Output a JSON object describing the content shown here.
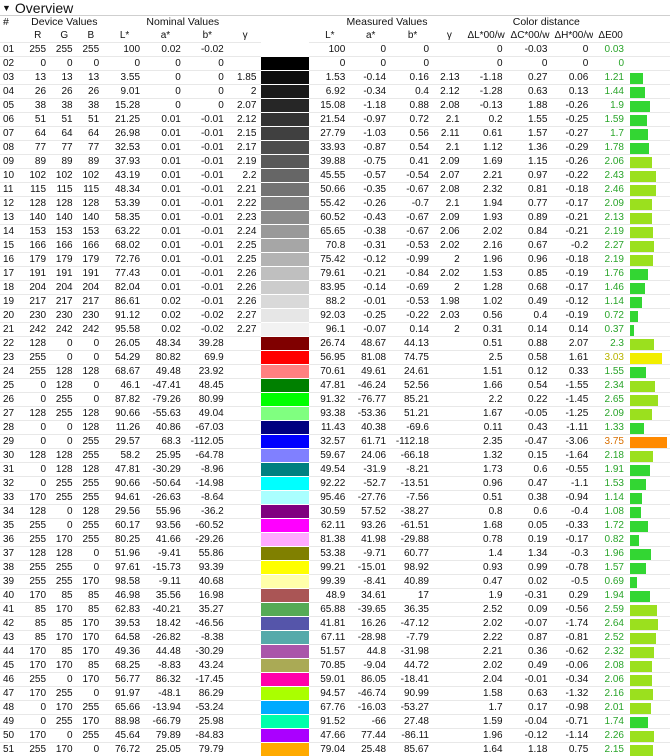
{
  "section": {
    "title": "Overview",
    "toggle_icon": "triangle-down"
  },
  "header": {
    "index": "#",
    "groups": {
      "device": "Device Values",
      "nominal": "Nominal Values",
      "measured": "Measured Values",
      "distance": "Color distance"
    },
    "device_cols": [
      "R",
      "G",
      "B"
    ],
    "nominal_cols": [
      "L*",
      "a*",
      "b*",
      "γ"
    ],
    "measured_cols": [
      "L*",
      "a*",
      "b*",
      "γ"
    ],
    "distance_cols": [
      "ΔL*00/w",
      "ΔC*00/w",
      "ΔH*00/w",
      "ΔE00"
    ]
  },
  "colors": {
    "green": "#33d633",
    "green_light": "#9be01e",
    "yellow": "#f2ee00",
    "orange": "#ff8a00"
  },
  "rows": [
    {
      "id": "01",
      "r": "255",
      "g": "255",
      "b": "255",
      "nl": "100",
      "na": "0.02",
      "nb": "-0.02",
      "ng": "",
      "swatch": "#ffffff",
      "ml": "100",
      "ma": "0",
      "mb": "0",
      "mg": "",
      "dl": "0",
      "dc": "-0.03",
      "dh": "0",
      "de": "0.03"
    },
    {
      "id": "02",
      "r": "0",
      "g": "0",
      "b": "0",
      "nl": "0",
      "na": "0",
      "nb": "0",
      "ng": "",
      "swatch": "#000000",
      "ml": "0",
      "ma": "0",
      "mb": "0",
      "mg": "",
      "dl": "0",
      "dc": "0",
      "dh": "0",
      "de": "0"
    },
    {
      "id": "03",
      "r": "13",
      "g": "13",
      "b": "13",
      "nl": "3.55",
      "na": "0",
      "nb": "0",
      "ng": "1.85",
      "swatch": "#0d0d0d",
      "ml": "1.53",
      "ma": "-0.14",
      "mb": "0.16",
      "mg": "2.13",
      "dl": "-1.18",
      "dc": "0.27",
      "dh": "0.06",
      "de": "1.21"
    },
    {
      "id": "04",
      "r": "26",
      "g": "26",
      "b": "26",
      "nl": "9.01",
      "na": "0",
      "nb": "0",
      "ng": "2",
      "swatch": "#1a1a1a",
      "ml": "6.92",
      "ma": "-0.34",
      "mb": "0.4",
      "mg": "2.12",
      "dl": "-1.28",
      "dc": "0.63",
      "dh": "0.13",
      "de": "1.44"
    },
    {
      "id": "05",
      "r": "38",
      "g": "38",
      "b": "38",
      "nl": "15.28",
      "na": "0",
      "nb": "0",
      "ng": "2.07",
      "swatch": "#262626",
      "ml": "15.08",
      "ma": "-1.18",
      "mb": "0.88",
      "mg": "2.08",
      "dl": "-0.13",
      "dc": "1.88",
      "dh": "-0.26",
      "de": "1.9"
    },
    {
      "id": "06",
      "r": "51",
      "g": "51",
      "b": "51",
      "nl": "21.25",
      "na": "0.01",
      "nb": "-0.01",
      "ng": "2.12",
      "swatch": "#333333",
      "ml": "21.54",
      "ma": "-0.97",
      "mb": "0.72",
      "mg": "2.1",
      "dl": "0.2",
      "dc": "1.55",
      "dh": "-0.25",
      "de": "1.59"
    },
    {
      "id": "07",
      "r": "64",
      "g": "64",
      "b": "64",
      "nl": "26.98",
      "na": "0.01",
      "nb": "-0.01",
      "ng": "2.15",
      "swatch": "#404040",
      "ml": "27.79",
      "ma": "-1.03",
      "mb": "0.56",
      "mg": "2.11",
      "dl": "0.61",
      "dc": "1.57",
      "dh": "-0.27",
      "de": "1.7"
    },
    {
      "id": "08",
      "r": "77",
      "g": "77",
      "b": "77",
      "nl": "32.53",
      "na": "0.01",
      "nb": "-0.01",
      "ng": "2.17",
      "swatch": "#4d4d4d",
      "ml": "33.93",
      "ma": "-0.87",
      "mb": "0.54",
      "mg": "2.1",
      "dl": "1.12",
      "dc": "1.36",
      "dh": "-0.29",
      "de": "1.78"
    },
    {
      "id": "09",
      "r": "89",
      "g": "89",
      "b": "89",
      "nl": "37.93",
      "na": "0.01",
      "nb": "-0.01",
      "ng": "2.19",
      "swatch": "#595959",
      "ml": "39.88",
      "ma": "-0.75",
      "mb": "0.41",
      "mg": "2.09",
      "dl": "1.69",
      "dc": "1.15",
      "dh": "-0.26",
      "de": "2.06"
    },
    {
      "id": "10",
      "r": "102",
      "g": "102",
      "b": "102",
      "nl": "43.19",
      "na": "0.01",
      "nb": "-0.01",
      "ng": "2.2",
      "swatch": "#666666",
      "ml": "45.55",
      "ma": "-0.57",
      "mb": "-0.54",
      "mg": "2.07",
      "dl": "2.21",
      "dc": "0.97",
      "dh": "-0.22",
      "de": "2.43"
    },
    {
      "id": "11",
      "r": "115",
      "g": "115",
      "b": "115",
      "nl": "48.34",
      "na": "0.01",
      "nb": "-0.01",
      "ng": "2.21",
      "swatch": "#737373",
      "ml": "50.66",
      "ma": "-0.35",
      "mb": "-0.67",
      "mg": "2.08",
      "dl": "2.32",
      "dc": "0.81",
      "dh": "-0.18",
      "de": "2.46"
    },
    {
      "id": "12",
      "r": "128",
      "g": "128",
      "b": "128",
      "nl": "53.39",
      "na": "0.01",
      "nb": "-0.01",
      "ng": "2.22",
      "swatch": "#808080",
      "ml": "55.42",
      "ma": "-0.26",
      "mb": "-0.7",
      "mg": "2.1",
      "dl": "1.94",
      "dc": "0.77",
      "dh": "-0.17",
      "de": "2.09"
    },
    {
      "id": "13",
      "r": "140",
      "g": "140",
      "b": "140",
      "nl": "58.35",
      "na": "0.01",
      "nb": "-0.01",
      "ng": "2.23",
      "swatch": "#8c8c8c",
      "ml": "60.52",
      "ma": "-0.43",
      "mb": "-0.67",
      "mg": "2.09",
      "dl": "1.93",
      "dc": "0.89",
      "dh": "-0.21",
      "de": "2.13"
    },
    {
      "id": "14",
      "r": "153",
      "g": "153",
      "b": "153",
      "nl": "63.22",
      "na": "0.01",
      "nb": "-0.01",
      "ng": "2.24",
      "swatch": "#999999",
      "ml": "65.65",
      "ma": "-0.38",
      "mb": "-0.67",
      "mg": "2.06",
      "dl": "2.02",
      "dc": "0.84",
      "dh": "-0.21",
      "de": "2.19"
    },
    {
      "id": "15",
      "r": "166",
      "g": "166",
      "b": "166",
      "nl": "68.02",
      "na": "0.01",
      "nb": "-0.01",
      "ng": "2.25",
      "swatch": "#a6a6a6",
      "ml": "70.8",
      "ma": "-0.31",
      "mb": "-0.53",
      "mg": "2.02",
      "dl": "2.16",
      "dc": "0.67",
      "dh": "-0.2",
      "de": "2.27"
    },
    {
      "id": "16",
      "r": "179",
      "g": "179",
      "b": "179",
      "nl": "72.76",
      "na": "0.01",
      "nb": "-0.01",
      "ng": "2.25",
      "swatch": "#b3b3b3",
      "ml": "75.42",
      "ma": "-0.12",
      "mb": "-0.99",
      "mg": "2",
      "dl": "1.96",
      "dc": "0.96",
      "dh": "-0.18",
      "de": "2.19"
    },
    {
      "id": "17",
      "r": "191",
      "g": "191",
      "b": "191",
      "nl": "77.43",
      "na": "0.01",
      "nb": "-0.01",
      "ng": "2.26",
      "swatch": "#bfbfbf",
      "ml": "79.61",
      "ma": "-0.21",
      "mb": "-0.84",
      "mg": "2.02",
      "dl": "1.53",
      "dc": "0.85",
      "dh": "-0.19",
      "de": "1.76"
    },
    {
      "id": "18",
      "r": "204",
      "g": "204",
      "b": "204",
      "nl": "82.04",
      "na": "0.01",
      "nb": "-0.01",
      "ng": "2.26",
      "swatch": "#cccccc",
      "ml": "83.95",
      "ma": "-0.14",
      "mb": "-0.69",
      "mg": "2",
      "dl": "1.28",
      "dc": "0.68",
      "dh": "-0.17",
      "de": "1.46"
    },
    {
      "id": "19",
      "r": "217",
      "g": "217",
      "b": "217",
      "nl": "86.61",
      "na": "0.02",
      "nb": "-0.01",
      "ng": "2.26",
      "swatch": "#d9d9d9",
      "ml": "88.2",
      "ma": "-0.01",
      "mb": "-0.53",
      "mg": "1.98",
      "dl": "1.02",
      "dc": "0.49",
      "dh": "-0.12",
      "de": "1.14"
    },
    {
      "id": "20",
      "r": "230",
      "g": "230",
      "b": "230",
      "nl": "91.12",
      "na": "0.02",
      "nb": "-0.02",
      "ng": "2.27",
      "swatch": "#e6e6e6",
      "ml": "92.03",
      "ma": "-0.25",
      "mb": "-0.22",
      "mg": "2.03",
      "dl": "0.56",
      "dc": "0.4",
      "dh": "-0.19",
      "de": "0.72"
    },
    {
      "id": "21",
      "r": "242",
      "g": "242",
      "b": "242",
      "nl": "95.58",
      "na": "0.02",
      "nb": "-0.02",
      "ng": "2.27",
      "swatch": "#f2f2f2",
      "ml": "96.1",
      "ma": "-0.07",
      "mb": "0.14",
      "mg": "2",
      "dl": "0.31",
      "dc": "0.14",
      "dh": "0.14",
      "de": "0.37"
    },
    {
      "id": "22",
      "r": "128",
      "g": "0",
      "b": "0",
      "nl": "26.05",
      "na": "48.34",
      "nb": "39.28",
      "ng": "",
      "swatch": "#800000",
      "ml": "26.74",
      "ma": "48.67",
      "mb": "44.13",
      "mg": "",
      "dl": "0.51",
      "dc": "0.88",
      "dh": "2.07",
      "de": "2.3"
    },
    {
      "id": "23",
      "r": "255",
      "g": "0",
      "b": "0",
      "nl": "54.29",
      "na": "80.82",
      "nb": "69.9",
      "ng": "",
      "swatch": "#ff0000",
      "ml": "56.95",
      "ma": "81.08",
      "mb": "74.75",
      "mg": "",
      "dl": "2.5",
      "dc": "0.58",
      "dh": "1.61",
      "de": "3.03"
    },
    {
      "id": "24",
      "r": "255",
      "g": "128",
      "b": "128",
      "nl": "68.67",
      "na": "49.48",
      "nb": "23.92",
      "ng": "",
      "swatch": "#ff8080",
      "ml": "70.61",
      "ma": "49.61",
      "mb": "24.61",
      "mg": "",
      "dl": "1.51",
      "dc": "0.12",
      "dh": "0.33",
      "de": "1.55"
    },
    {
      "id": "25",
      "r": "0",
      "g": "128",
      "b": "0",
      "nl": "46.1",
      "na": "-47.41",
      "nb": "48.45",
      "ng": "",
      "swatch": "#008000",
      "ml": "47.81",
      "ma": "-46.24",
      "mb": "52.56",
      "mg": "",
      "dl": "1.66",
      "dc": "0.54",
      "dh": "-1.55",
      "de": "2.34"
    },
    {
      "id": "26",
      "r": "0",
      "g": "255",
      "b": "0",
      "nl": "87.82",
      "na": "-79.26",
      "nb": "80.99",
      "ng": "",
      "swatch": "#00ff00",
      "ml": "91.32",
      "ma": "-76.77",
      "mb": "85.21",
      "mg": "",
      "dl": "2.2",
      "dc": "0.22",
      "dh": "-1.45",
      "de": "2.65"
    },
    {
      "id": "27",
      "r": "128",
      "g": "255",
      "b": "128",
      "nl": "90.66",
      "na": "-55.63",
      "nb": "49.04",
      "ng": "",
      "swatch": "#80ff80",
      "ml": "93.38",
      "ma": "-53.36",
      "mb": "51.21",
      "mg": "",
      "dl": "1.67",
      "dc": "-0.05",
      "dh": "-1.25",
      "de": "2.09"
    },
    {
      "id": "28",
      "r": "0",
      "g": "0",
      "b": "128",
      "nl": "11.26",
      "na": "40.86",
      "nb": "-67.03",
      "ng": "",
      "swatch": "#000080",
      "ml": "11.43",
      "ma": "40.38",
      "mb": "-69.6",
      "mg": "",
      "dl": "0.11",
      "dc": "0.43",
      "dh": "-1.11",
      "de": "1.33"
    },
    {
      "id": "29",
      "r": "0",
      "g": "0",
      "b": "255",
      "nl": "29.57",
      "na": "68.3",
      "nb": "-112.05",
      "ng": "",
      "swatch": "#0000ff",
      "ml": "32.57",
      "ma": "61.71",
      "mb": "-112.18",
      "mg": "",
      "dl": "2.35",
      "dc": "-0.47",
      "dh": "-3.06",
      "de": "3.75"
    },
    {
      "id": "30",
      "r": "128",
      "g": "128",
      "b": "255",
      "nl": "58.2",
      "na": "25.95",
      "nb": "-64.78",
      "ng": "",
      "swatch": "#8080ff",
      "ml": "59.67",
      "ma": "24.06",
      "mb": "-66.18",
      "mg": "",
      "dl": "1.32",
      "dc": "0.15",
      "dh": "-1.64",
      "de": "2.18"
    },
    {
      "id": "31",
      "r": "0",
      "g": "128",
      "b": "128",
      "nl": "47.81",
      "na": "-30.29",
      "nb": "-8.96",
      "ng": "",
      "swatch": "#008080",
      "ml": "49.54",
      "ma": "-31.9",
      "mb": "-8.21",
      "mg": "",
      "dl": "1.73",
      "dc": "0.6",
      "dh": "-0.55",
      "de": "1.91"
    },
    {
      "id": "32",
      "r": "0",
      "g": "255",
      "b": "255",
      "nl": "90.66",
      "na": "-50.64",
      "nb": "-14.98",
      "ng": "",
      "swatch": "#00ffff",
      "ml": "92.22",
      "ma": "-52.7",
      "mb": "-13.51",
      "mg": "",
      "dl": "0.96",
      "dc": "0.47",
      "dh": "-1.1",
      "de": "1.53"
    },
    {
      "id": "33",
      "r": "170",
      "g": "255",
      "b": "255",
      "nl": "94.61",
      "na": "-26.63",
      "nb": "-8.64",
      "ng": "",
      "swatch": "#aaffff",
      "ml": "95.46",
      "ma": "-27.76",
      "mb": "-7.56",
      "mg": "",
      "dl": "0.51",
      "dc": "0.38",
      "dh": "-0.94",
      "de": "1.14"
    },
    {
      "id": "34",
      "r": "128",
      "g": "0",
      "b": "128",
      "nl": "29.56",
      "na": "55.96",
      "nb": "-36.2",
      "ng": "",
      "swatch": "#800080",
      "ml": "30.59",
      "ma": "57.52",
      "mb": "-38.27",
      "mg": "",
      "dl": "0.8",
      "dc": "0.6",
      "dh": "-0.4",
      "de": "1.08"
    },
    {
      "id": "35",
      "r": "255",
      "g": "0",
      "b": "255",
      "nl": "60.17",
      "na": "93.56",
      "nb": "-60.52",
      "ng": "",
      "swatch": "#ff00ff",
      "ml": "62.11",
      "ma": "93.26",
      "mb": "-61.51",
      "mg": "",
      "dl": "1.68",
      "dc": "0.05",
      "dh": "-0.33",
      "de": "1.72"
    },
    {
      "id": "36",
      "r": "255",
      "g": "170",
      "b": "255",
      "nl": "80.25",
      "na": "41.66",
      "nb": "-29.26",
      "ng": "",
      "swatch": "#ffaaff",
      "ml": "81.38",
      "ma": "41.98",
      "mb": "-29.88",
      "mg": "",
      "dl": "0.78",
      "dc": "0.19",
      "dh": "-0.17",
      "de": "0.82"
    },
    {
      "id": "37",
      "r": "128",
      "g": "128",
      "b": "0",
      "nl": "51.96",
      "na": "-9.41",
      "nb": "55.86",
      "ng": "",
      "swatch": "#808000",
      "ml": "53.38",
      "ma": "-9.71",
      "mb": "60.77",
      "mg": "",
      "dl": "1.4",
      "dc": "1.34",
      "dh": "-0.3",
      "de": "1.96"
    },
    {
      "id": "38",
      "r": "255",
      "g": "255",
      "b": "0",
      "nl": "97.61",
      "na": "-15.73",
      "nb": "93.39",
      "ng": "",
      "swatch": "#ffff00",
      "ml": "99.21",
      "ma": "-15.01",
      "mb": "98.92",
      "mg": "",
      "dl": "0.93",
      "dc": "0.99",
      "dh": "-0.78",
      "de": "1.57"
    },
    {
      "id": "39",
      "r": "255",
      "g": "255",
      "b": "170",
      "nl": "98.58",
      "na": "-9.11",
      "nb": "40.68",
      "ng": "",
      "swatch": "#ffffaa",
      "ml": "99.39",
      "ma": "-8.41",
      "mb": "40.89",
      "mg": "",
      "dl": "0.47",
      "dc": "0.02",
      "dh": "-0.5",
      "de": "0.69"
    },
    {
      "id": "40",
      "r": "170",
      "g": "85",
      "b": "85",
      "nl": "46.98",
      "na": "35.56",
      "nb": "16.98",
      "ng": "",
      "swatch": "#aa5555",
      "ml": "48.9",
      "ma": "34.61",
      "mb": "17",
      "mg": "",
      "dl": "1.9",
      "dc": "-0.31",
      "dh": "0.29",
      "de": "1.94"
    },
    {
      "id": "41",
      "r": "85",
      "g": "170",
      "b": "85",
      "nl": "62.83",
      "na": "-40.21",
      "nb": "35.27",
      "ng": "",
      "swatch": "#55aa55",
      "ml": "65.88",
      "ma": "-39.65",
      "mb": "36.35",
      "mg": "",
      "dl": "2.52",
      "dc": "0.09",
      "dh": "-0.56",
      "de": "2.59"
    },
    {
      "id": "42",
      "r": "85",
      "g": "85",
      "b": "170",
      "nl": "39.53",
      "na": "18.42",
      "nb": "-46.56",
      "ng": "",
      "swatch": "#5555aa",
      "ml": "41.81",
      "ma": "16.26",
      "mb": "-47.12",
      "mg": "",
      "dl": "2.02",
      "dc": "-0.07",
      "dh": "-1.74",
      "de": "2.64"
    },
    {
      "id": "43",
      "r": "85",
      "g": "170",
      "b": "170",
      "nl": "64.58",
      "na": "-26.82",
      "nb": "-8.38",
      "ng": "",
      "swatch": "#55aaaa",
      "ml": "67.11",
      "ma": "-28.98",
      "mb": "-7.79",
      "mg": "",
      "dl": "2.22",
      "dc": "0.87",
      "dh": "-0.81",
      "de": "2.52"
    },
    {
      "id": "44",
      "r": "170",
      "g": "85",
      "b": "170",
      "nl": "49.36",
      "na": "44.48",
      "nb": "-30.29",
      "ng": "",
      "swatch": "#aa55aa",
      "ml": "51.57",
      "ma": "44.8",
      "mb": "-31.98",
      "mg": "",
      "dl": "2.21",
      "dc": "0.36",
      "dh": "-0.62",
      "de": "2.32"
    },
    {
      "id": "45",
      "r": "170",
      "g": "170",
      "b": "85",
      "nl": "68.25",
      "na": "-8.83",
      "nb": "43.24",
      "ng": "",
      "swatch": "#aaaa55",
      "ml": "70.85",
      "ma": "-9.04",
      "mb": "44.72",
      "mg": "",
      "dl": "2.02",
      "dc": "0.49",
      "dh": "-0.06",
      "de": "2.08"
    },
    {
      "id": "46",
      "r": "255",
      "g": "0",
      "b": "170",
      "nl": "56.77",
      "na": "86.32",
      "nb": "-17.45",
      "ng": "",
      "swatch": "#ff00aa",
      "ml": "59.01",
      "ma": "86.05",
      "mb": "-18.41",
      "mg": "",
      "dl": "2.04",
      "dc": "-0.01",
      "dh": "-0.34",
      "de": "2.06"
    },
    {
      "id": "47",
      "r": "170",
      "g": "255",
      "b": "0",
      "nl": "91.97",
      "na": "-48.1",
      "nb": "86.29",
      "ng": "",
      "swatch": "#aaff00",
      "ml": "94.57",
      "ma": "-46.74",
      "mb": "90.99",
      "mg": "",
      "dl": "1.58",
      "dc": "0.63",
      "dh": "-1.32",
      "de": "2.16"
    },
    {
      "id": "48",
      "r": "0",
      "g": "170",
      "b": "255",
      "nl": "65.66",
      "na": "-13.94",
      "nb": "-53.24",
      "ng": "",
      "swatch": "#00aaff",
      "ml": "67.76",
      "ma": "-16.03",
      "mb": "-53.27",
      "mg": "",
      "dl": "1.7",
      "dc": "0.17",
      "dh": "-0.98",
      "de": "2.01"
    },
    {
      "id": "49",
      "r": "0",
      "g": "255",
      "b": "170",
      "nl": "88.98",
      "na": "-66.79",
      "nb": "25.98",
      "ng": "",
      "swatch": "#00ffaa",
      "ml": "91.52",
      "ma": "-66",
      "mb": "27.48",
      "mg": "",
      "dl": "1.59",
      "dc": "-0.04",
      "dh": "-0.71",
      "de": "1.74"
    },
    {
      "id": "50",
      "r": "170",
      "g": "0",
      "b": "255",
      "nl": "45.64",
      "na": "79.89",
      "nb": "-84.83",
      "ng": "",
      "swatch": "#aa00ff",
      "ml": "47.66",
      "ma": "77.44",
      "mb": "-86.11",
      "mg": "",
      "dl": "1.96",
      "dc": "-0.12",
      "dh": "-1.14",
      "de": "2.26"
    },
    {
      "id": "51",
      "r": "255",
      "g": "170",
      "b": "0",
      "nl": "76.72",
      "na": "25.05",
      "nb": "79.79",
      "ng": "",
      "swatch": "#ffaa00",
      "ml": "79.04",
      "ma": "25.48",
      "mb": "85.67",
      "mg": "",
      "dl": "1.64",
      "dc": "1.18",
      "dh": "0.75",
      "de": "2.15"
    }
  ]
}
